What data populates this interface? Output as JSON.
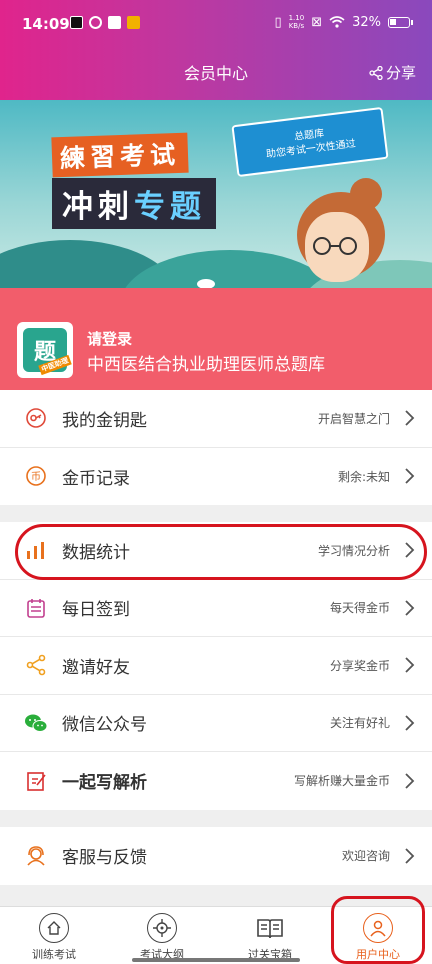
{
  "status": {
    "time": "14:09",
    "net_speed": "1.10",
    "net_unit": "KB/s",
    "battery": "32%"
  },
  "header": {
    "title": "会员中心",
    "share": "分享"
  },
  "banner": {
    "line1": "練習考试",
    "line2a": "冲刺",
    "line2b": "专题",
    "cloud_line1": "总题库",
    "cloud_line2": "助您考试一次性通过"
  },
  "profile": {
    "login": "请登录",
    "question_bank": "中西医结合执业助理医师总题库",
    "logo_text": "题",
    "logo_tag": "中医助理"
  },
  "menu_group1": [
    {
      "label": "我的金钥匙",
      "hint": "开启智慧之门",
      "icon": "key-icon",
      "color": "#e04a3a"
    },
    {
      "label": "金币记录",
      "hint": "剩余:未知",
      "icon": "coin-icon",
      "color": "#e8711d"
    }
  ],
  "menu_group2": [
    {
      "label": "数据统计",
      "hint": "学习情况分析",
      "icon": "bar-chart-icon",
      "color": "#e8711d"
    },
    {
      "label": "每日签到",
      "hint": "每天得金币",
      "icon": "calendar-icon",
      "color": "#c2408f"
    },
    {
      "label": "邀请好友",
      "hint": "分享奖金币",
      "icon": "share-nodes-icon",
      "color": "#f0a020"
    },
    {
      "label": "微信公众号",
      "hint": "关注有好礼",
      "icon": "wechat-icon",
      "color": "#2aae3b"
    },
    {
      "label": "一起写解析",
      "hint": "写解析赚大量金币",
      "icon": "edit-icon",
      "color": "#d93030",
      "bold": true
    }
  ],
  "menu_group3": [
    {
      "label": "客服与反馈",
      "hint": "欢迎咨询",
      "icon": "support-icon",
      "color": "#e8711d"
    }
  ],
  "tabs": [
    {
      "label": "训练考试",
      "icon": "home-icon"
    },
    {
      "label": "考试大纲",
      "icon": "target-icon"
    },
    {
      "label": "过关宝箱",
      "icon": "book-icon"
    },
    {
      "label": "用户中心",
      "icon": "user-icon",
      "active": true
    }
  ],
  "accent": "#e8611d"
}
